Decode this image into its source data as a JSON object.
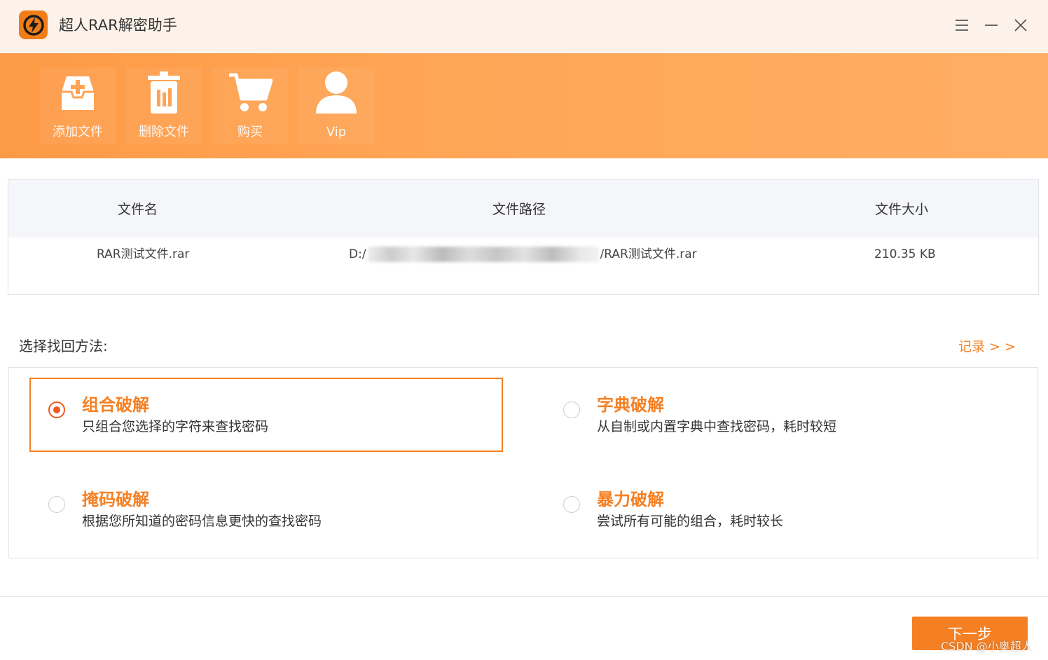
{
  "titlebar": {
    "title": "超人RAR解密助手"
  },
  "toolbar": {
    "buttons": [
      {
        "label": "添加文件",
        "icon": "add-file-icon"
      },
      {
        "label": "删除文件",
        "icon": "trash-icon"
      },
      {
        "label": "购买",
        "icon": "cart-icon"
      },
      {
        "label": "Vip",
        "icon": "user-icon"
      }
    ]
  },
  "table": {
    "headers": [
      "文件名",
      "文件路径",
      "文件大小"
    ],
    "rows": [
      {
        "name": "RAR测试文件.rar",
        "path_prefix": "D:/",
        "path_suffix": "/RAR测试文件.rar",
        "size": "210.35 KB"
      }
    ]
  },
  "methods": {
    "section_title": "选择找回方法:",
    "records_link": "记录 > >",
    "options": [
      {
        "title": "组合破解",
        "desc": "只组合您选择的字符来查找密码",
        "selected": true
      },
      {
        "title": "字典破解",
        "desc": "从自制或内置字典中查找密码，耗时较短",
        "selected": false
      },
      {
        "title": "掩码破解",
        "desc": "根据您所知道的密码信息更快的查找密码",
        "selected": false
      },
      {
        "title": "暴力破解",
        "desc": "尝试所有可能的组合，耗时较长",
        "selected": false
      }
    ]
  },
  "footer": {
    "next_label": "下一步",
    "watermark": "CSDN @小奥超人"
  },
  "colors": {
    "accent": "#f58023",
    "radio_on": "#f05a1e",
    "toolbar_start": "#fd9a45",
    "toolbar_end": "#ffae64",
    "titlebar_bg": "#fdf2ea"
  }
}
